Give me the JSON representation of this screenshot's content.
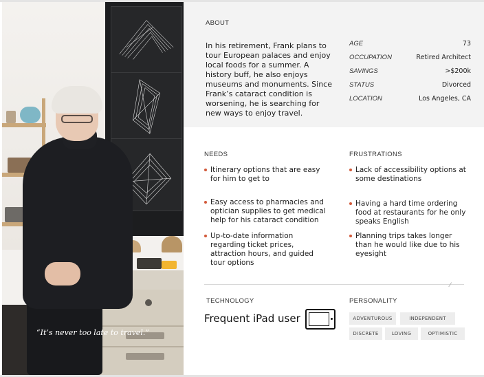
{
  "photo": {
    "quote": "“It’s never too late to travel.”"
  },
  "about": {
    "heading": "ABOUT",
    "text": "In his retirement, Frank plans to tour European palaces and enjoy local foods for a summer. A history buff, he also enjoys museums and monuments. Since Frank’s cataract condition is worsening, he is searching for new ways to enjoy travel."
  },
  "facts": [
    {
      "label": "AGE",
      "value": "73"
    },
    {
      "label": "OCCUPATION",
      "value": "Retired Architect"
    },
    {
      "label": "SAVINGS",
      "value": ">$200k"
    },
    {
      "label": "STATUS",
      "value": "Divorced"
    },
    {
      "label": "LOCATION",
      "value": "Los Angeles, CA"
    }
  ],
  "needs": {
    "heading": "NEEDS",
    "items": [
      "Itinerary options that are easy for him to get to",
      "Easy access to pharmacies and optician supplies to get medical help for his cataract condition",
      "Up-to-date information regarding ticket prices, attraction hours, and guided tour options"
    ]
  },
  "frustrations": {
    "heading": "FRUSTRATIONS",
    "items": [
      "Lack of accessibility options at some destinations",
      "Having a hard time ordering food at restaurants for he only speaks English",
      "Planning trips takes longer than he would like due to his eyesight"
    ]
  },
  "technology": {
    "heading": "TECHNOLOGY",
    "text": "Frequent iPad user",
    "icon": "tablet-icon"
  },
  "personality": {
    "heading": "PERSONALITY",
    "tags": [
      "ADVENTUROUS",
      "INDEPENDENT",
      "DISCRETE",
      "LOVING",
      "OPTIMISTIC"
    ]
  },
  "colors": {
    "bullet": "#d25a3a",
    "band": "#f3f3f3",
    "tag": "#ededed"
  }
}
